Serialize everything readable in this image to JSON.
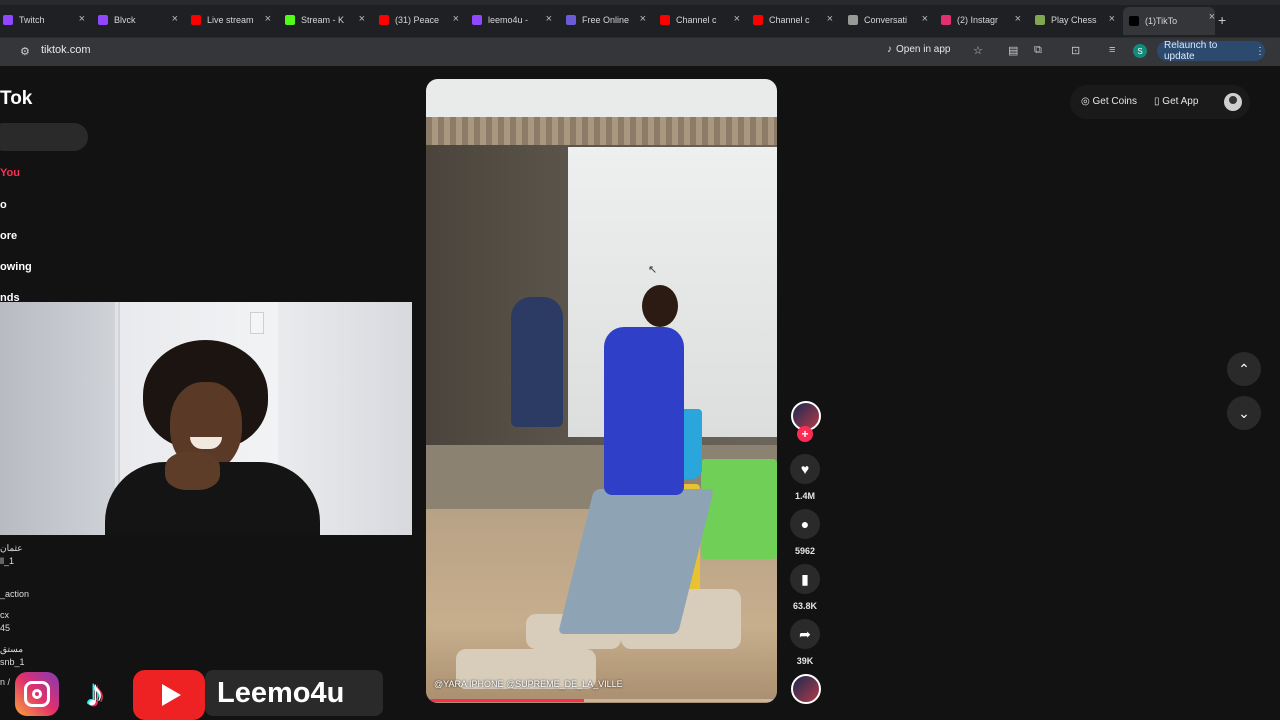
{
  "browser": {
    "tabs": [
      {
        "label": "Twitch",
        "color": "#9146ff"
      },
      {
        "label": "Blvck",
        "color": "#9146ff"
      },
      {
        "label": "Live stream",
        "color": "#ff0000"
      },
      {
        "label": "Stream - K",
        "color": "#53fc18"
      },
      {
        "label": "(31) Peace",
        "color": "#ff0000"
      },
      {
        "label": "leemo4u -",
        "color": "#9146ff"
      },
      {
        "label": "Free Online",
        "color": "#6b5bd6"
      },
      {
        "label": "Channel c",
        "color": "#ff0000"
      },
      {
        "label": "Channel c",
        "color": "#ff0000"
      },
      {
        "label": "Conversati",
        "color": "#999999"
      },
      {
        "label": "(2) Instagr",
        "color": "#e1306c"
      },
      {
        "label": "Play Chess",
        "color": "#7fa650"
      },
      {
        "label": "(1)TikTo",
        "color": "#000000"
      }
    ],
    "url": "tiktok.com",
    "open_in_app": "Open in app",
    "profile_initial": "S",
    "relaunch": "Relaunch to update"
  },
  "tiktok": {
    "logo": "Tok",
    "nav": [
      {
        "label": "You",
        "active": true
      },
      {
        "label": "o",
        "active": false
      },
      {
        "label": "ore",
        "active": false
      },
      {
        "label": "owing",
        "active": false
      },
      {
        "label": "nds",
        "active": false
      }
    ],
    "left_list": [
      "عثمان",
      "ll_1",
      "_action",
      "cx",
      "45",
      "مستق",
      "snb_1",
      "n /"
    ],
    "video": {
      "caption": "@YARA IPHONE   @SUPREME_DE_LA_VILLE",
      "progress": 0.45
    },
    "actions": {
      "likes": "1.4M",
      "comments": "5962",
      "saves": "63.8K",
      "shares": "39K"
    },
    "top": {
      "get_coins": "Get Coins",
      "get_app": "Get App"
    }
  },
  "overlay": {
    "handle": "Leemo4u"
  }
}
